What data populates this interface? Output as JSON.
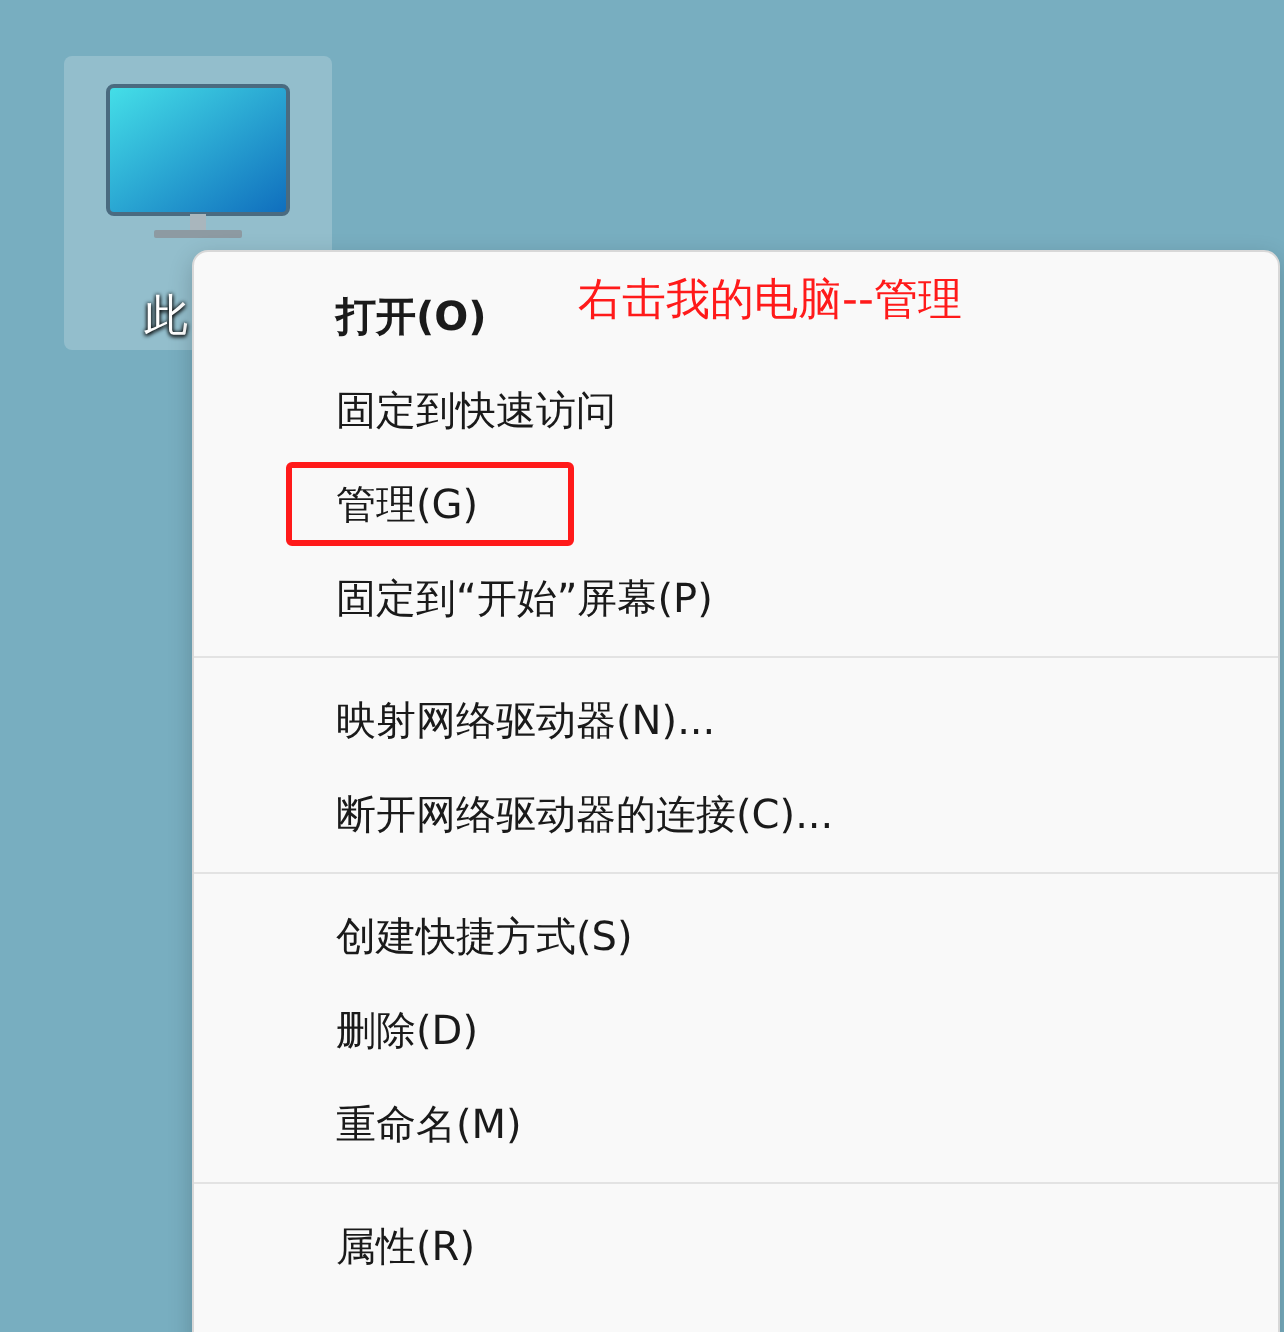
{
  "desktop_icon": {
    "label": "此",
    "selected": true
  },
  "context_menu": {
    "groups": [
      [
        {
          "label": "打开(O)",
          "default": true,
          "annotated": false
        },
        {
          "label": "固定到快速访问",
          "default": false,
          "annotated": false
        },
        {
          "label": "管理(G)",
          "default": false,
          "annotated": true
        },
        {
          "label": "固定到“开始”屏幕(P)",
          "default": false,
          "annotated": false
        }
      ],
      [
        {
          "label": "映射网络驱动器(N)...",
          "default": false,
          "annotated": false
        },
        {
          "label": "断开网络驱动器的连接(C)...",
          "default": false,
          "annotated": false
        }
      ],
      [
        {
          "label": "创建快捷方式(S)",
          "default": false,
          "annotated": false
        },
        {
          "label": "删除(D)",
          "default": false,
          "annotated": false
        },
        {
          "label": "重命名(M)",
          "default": false,
          "annotated": false
        }
      ],
      [
        {
          "label": "属性(R)",
          "default": false,
          "annotated": false
        }
      ]
    ]
  },
  "annotation": {
    "text": "右击我的电脑--管理"
  }
}
